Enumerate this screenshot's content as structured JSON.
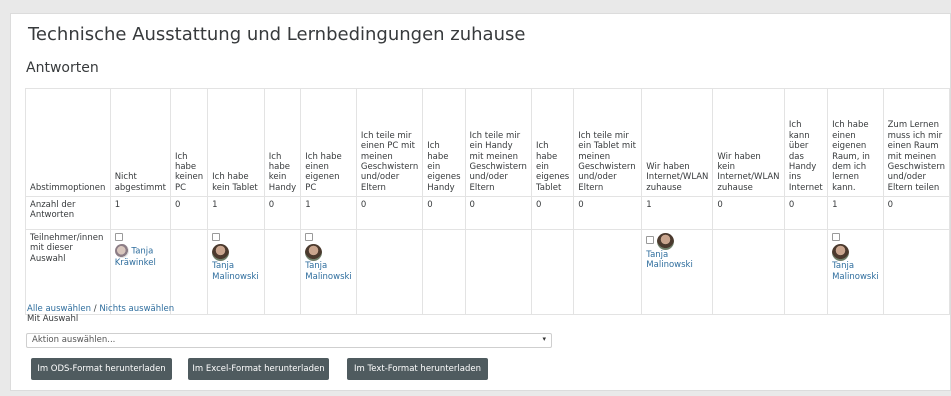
{
  "page": {
    "title": "Technische Ausstattung und Lernbedingungen zuhause",
    "subtitle": "Antworten"
  },
  "table": {
    "row_header": "Abstimmoptionen",
    "columns": [
      "Nicht abgestimmt",
      "Ich habe keinen PC",
      "Ich habe kein Tablet",
      "Ich habe kein Handy",
      "Ich habe einen eigenen PC",
      "Ich teile mir einen PC mit meinen Geschwistern und/oder Eltern",
      "Ich habe ein eigenes Handy",
      "Ich teile mir ein Handy mit meinen Geschwistern und/oder Eltern",
      "Ich habe ein eigenes Tablet",
      "Ich teile mir ein Tablet mit meinen Geschwistern und/oder Eltern",
      "Wir haben Internet/WLAN zuhause",
      "Wir haben kein Internet/WLAN zuhause",
      "Ich kann über das Handy ins Internet",
      "Ich habe einen eigenen Raum, in dem ich lernen kann.",
      "Zum Lernen muss ich mir einen Raum mit meinen Geschwistern und/oder Eltern teilen"
    ],
    "count_label": "Anzahl der Antworten",
    "counts": [
      "1",
      "0",
      "1",
      "0",
      "1",
      "0",
      "0",
      "0",
      "0",
      "0",
      "1",
      "0",
      "0",
      "1",
      "0"
    ],
    "users_label": "Teilnehmer/innen mit dieser Auswahl",
    "users": {
      "c0": "Tanja Kräwinkel",
      "c2": "Tanja Malinowski",
      "c4": "Tanja Malinowski",
      "c10": "Tanja Malinowski",
      "c13": "Tanja Malinowski"
    }
  },
  "bottom": {
    "select_all": "Alle auswählen",
    "separator": " / ",
    "select_none": "Nichts auswählen",
    "with_selection": "Mit Auswahl",
    "action_value": "Aktion auswählen...",
    "action_arrow": "▾"
  },
  "buttons": {
    "ods": "Im ODS-Format herunterladen",
    "excel": "Im Excel-Format herunterladen",
    "text": "Im Text-Format herunterladen"
  },
  "colors": {
    "link": "#2f6e9e",
    "button_bg": "#4f5b5f",
    "title": "#373a3c"
  },
  "icons": {
    "checkbox": "checkbox-icon",
    "avatar": "user-avatar-icon"
  }
}
